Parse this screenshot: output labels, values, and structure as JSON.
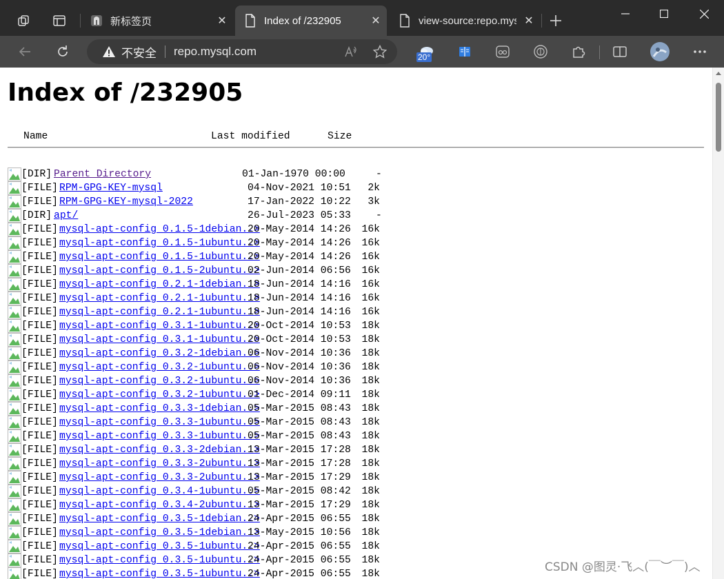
{
  "browser": {
    "tabs": [
      {
        "title": "新标签页",
        "active": false
      },
      {
        "title": "Index of /232905",
        "active": true
      },
      {
        "title": "view-source:repo.mysql.com",
        "active": false
      }
    ],
    "address": {
      "security_label": "不安全",
      "url": "repo.mysql.com"
    },
    "weather_temp": "20°"
  },
  "page": {
    "heading": "Index of /232905",
    "columns": {
      "name": "Name",
      "modified": "Last modified",
      "size": "Size"
    },
    "entries": [
      {
        "tag": "[DIR]",
        "name": "Parent Directory",
        "modified": "01-Jan-1970 00:00",
        "size": "-",
        "visited": true
      },
      {
        "tag": "[FILE]",
        "name": "RPM-GPG-KEY-mysql",
        "modified": "04-Nov-2021 10:51",
        "size": "2k"
      },
      {
        "tag": "[FILE]",
        "name": "RPM-GPG-KEY-mysql-2022",
        "modified": "17-Jan-2022 10:22",
        "size": "3k"
      },
      {
        "tag": "[DIR]",
        "name": "apt/",
        "modified": "26-Jul-2023 05:33",
        "size": "-"
      },
      {
        "tag": "[FILE]",
        "name": "mysql-apt-config_0.1.5-1debian..>",
        "modified": "20-May-2014 14:26",
        "size": "16k"
      },
      {
        "tag": "[FILE]",
        "name": "mysql-apt-config_0.1.5-1ubuntu..>",
        "modified": "20-May-2014 14:26",
        "size": "16k"
      },
      {
        "tag": "[FILE]",
        "name": "mysql-apt-config_0.1.5-1ubuntu..>",
        "modified": "20-May-2014 14:26",
        "size": "16k"
      },
      {
        "tag": "[FILE]",
        "name": "mysql-apt-config_0.1.5-2ubuntu..>",
        "modified": "02-Jun-2014 06:56",
        "size": "16k"
      },
      {
        "tag": "[FILE]",
        "name": "mysql-apt-config_0.2.1-1debian..>",
        "modified": "18-Jun-2014 14:16",
        "size": "16k"
      },
      {
        "tag": "[FILE]",
        "name": "mysql-apt-config_0.2.1-1ubuntu..>",
        "modified": "18-Jun-2014 14:16",
        "size": "16k"
      },
      {
        "tag": "[FILE]",
        "name": "mysql-apt-config_0.2.1-1ubuntu..>",
        "modified": "18-Jun-2014 14:16",
        "size": "16k"
      },
      {
        "tag": "[FILE]",
        "name": "mysql-apt-config_0.3.1-1ubuntu..>",
        "modified": "20-Oct-2014 10:53",
        "size": "18k"
      },
      {
        "tag": "[FILE]",
        "name": "mysql-apt-config_0.3.1-1ubuntu..>",
        "modified": "20-Oct-2014 10:53",
        "size": "18k"
      },
      {
        "tag": "[FILE]",
        "name": "mysql-apt-config_0.3.2-1debian..>",
        "modified": "06-Nov-2014 10:36",
        "size": "18k"
      },
      {
        "tag": "[FILE]",
        "name": "mysql-apt-config_0.3.2-1ubuntu..>",
        "modified": "06-Nov-2014 10:36",
        "size": "18k"
      },
      {
        "tag": "[FILE]",
        "name": "mysql-apt-config_0.3.2-1ubuntu..>",
        "modified": "06-Nov-2014 10:36",
        "size": "18k"
      },
      {
        "tag": "[FILE]",
        "name": "mysql-apt-config_0.3.2-1ubuntu..>",
        "modified": "01-Dec-2014 09:11",
        "size": "18k"
      },
      {
        "tag": "[FILE]",
        "name": "mysql-apt-config_0.3.3-1debian..>",
        "modified": "05-Mar-2015 08:43",
        "size": "18k"
      },
      {
        "tag": "[FILE]",
        "name": "mysql-apt-config_0.3.3-1ubuntu..>",
        "modified": "05-Mar-2015 08:43",
        "size": "18k"
      },
      {
        "tag": "[FILE]",
        "name": "mysql-apt-config_0.3.3-1ubuntu..>",
        "modified": "05-Mar-2015 08:43",
        "size": "18k"
      },
      {
        "tag": "[FILE]",
        "name": "mysql-apt-config_0.3.3-2debian..>",
        "modified": "13-Mar-2015 17:28",
        "size": "18k"
      },
      {
        "tag": "[FILE]",
        "name": "mysql-apt-config_0.3.3-2ubuntu..>",
        "modified": "13-Mar-2015 17:28",
        "size": "18k"
      },
      {
        "tag": "[FILE]",
        "name": "mysql-apt-config_0.3.3-2ubuntu..>",
        "modified": "13-Mar-2015 17:29",
        "size": "18k"
      },
      {
        "tag": "[FILE]",
        "name": "mysql-apt-config_0.3.4-1ubuntu..>",
        "modified": "05-Mar-2015 08:42",
        "size": "18k"
      },
      {
        "tag": "[FILE]",
        "name": "mysql-apt-config_0.3.4-2ubuntu..>",
        "modified": "13-Mar-2015 17:29",
        "size": "18k"
      },
      {
        "tag": "[FILE]",
        "name": "mysql-apt-config_0.3.5-1debian..>",
        "modified": "24-Apr-2015 06:55",
        "size": "18k"
      },
      {
        "tag": "[FILE]",
        "name": "mysql-apt-config_0.3.5-1debian..>",
        "modified": "13-May-2015 10:56",
        "size": "18k"
      },
      {
        "tag": "[FILE]",
        "name": "mysql-apt-config_0.3.5-1ubuntu..>",
        "modified": "24-Apr-2015 06:55",
        "size": "18k"
      },
      {
        "tag": "[FILE]",
        "name": "mysql-apt-config_0.3.5-1ubuntu..>",
        "modified": "24-Apr-2015 06:55",
        "size": "18k"
      },
      {
        "tag": "[FILE]",
        "name": "mysql-apt-config_0.3.5-1ubuntu..>",
        "modified": "24-Apr-2015 06:55",
        "size": "18k"
      }
    ]
  },
  "watermark": "CSDN @图灵·飞︿(￣︶￣)︿",
  "colors": {
    "link": "#0000ee",
    "visited_link": "#551a8b",
    "tabstrip": "#2b2b2b",
    "toolbar": "#474747"
  }
}
